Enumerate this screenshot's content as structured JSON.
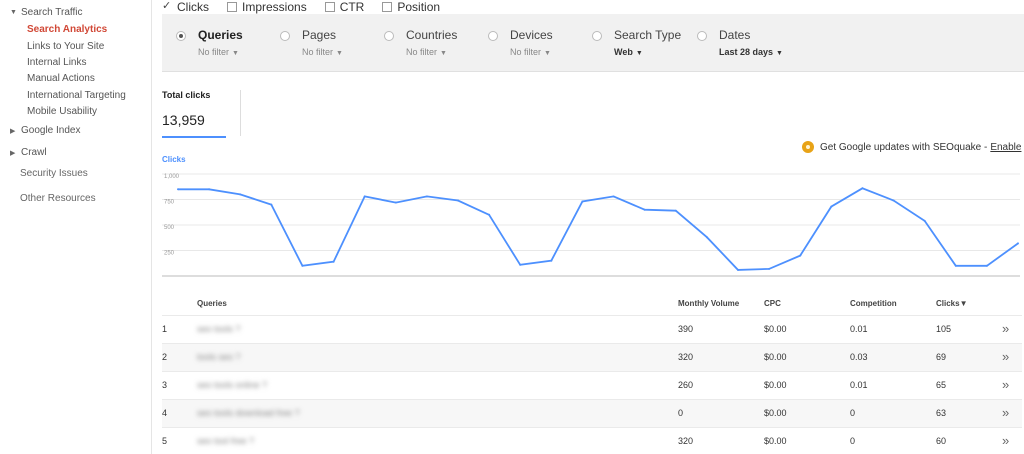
{
  "sidebar": {
    "search_traffic": "Search Traffic",
    "sub_items": [
      "Search Analytics",
      "Links to Your Site",
      "Internal Links",
      "Manual Actions",
      "International Targeting",
      "Mobile Usability"
    ],
    "google_index": "Google Index",
    "crawl": "Crawl",
    "security_issues": "Security Issues",
    "other_resources": "Other Resources"
  },
  "metrics": [
    {
      "label": "Clicks",
      "checked": true
    },
    {
      "label": "Impressions",
      "checked": false
    },
    {
      "label": "CTR",
      "checked": false
    },
    {
      "label": "Position",
      "checked": false
    }
  ],
  "filters": [
    {
      "label": "Queries",
      "sub": "No filter",
      "selected": true
    },
    {
      "label": "Pages",
      "sub": "No filter",
      "selected": false
    },
    {
      "label": "Countries",
      "sub": "No filter",
      "selected": false
    },
    {
      "label": "Devices",
      "sub": "No filter",
      "selected": false
    },
    {
      "label": "Search Type",
      "sub": "Web",
      "selected": false
    },
    {
      "label": "Dates",
      "sub": "Last 28 days",
      "selected": false
    }
  ],
  "total": {
    "label": "Total clicks",
    "value": "13,959"
  },
  "seoquake": {
    "text": "Get Google updates with SEOquake -",
    "link": "Enable"
  },
  "chart_data": {
    "type": "line",
    "title": "Clicks",
    "ylim": [
      0,
      1000
    ],
    "yticks": [
      "1,000",
      "750",
      "500",
      "250"
    ],
    "ytick_values": [
      1000,
      750,
      500,
      250
    ],
    "series": [
      {
        "values": [
          850,
          850,
          800,
          700,
          100,
          140,
          780,
          720,
          780,
          740,
          600,
          110,
          150,
          730,
          780,
          650,
          640,
          380,
          60,
          70,
          200,
          680,
          860,
          740,
          540,
          100,
          100,
          320
        ]
      }
    ],
    "color": "#4d90fe"
  },
  "table": {
    "headers": [
      "Queries",
      "Monthly Volume",
      "CPC",
      "Competition",
      "Clicks"
    ],
    "sort_marker": "▼",
    "rows": [
      {
        "n": "1",
        "query": "seo tools ?",
        "volume": "390",
        "cpc": "$0.00",
        "comp": "0.01",
        "clicks": "105"
      },
      {
        "n": "2",
        "query": "tools seo ?",
        "volume": "320",
        "cpc": "$0.00",
        "comp": "0.03",
        "clicks": "69"
      },
      {
        "n": "3",
        "query": "seo tools online ?",
        "volume": "260",
        "cpc": "$0.00",
        "comp": "0.01",
        "clicks": "65"
      },
      {
        "n": "4",
        "query": "seo tools download free ?",
        "volume": "0",
        "cpc": "$0.00",
        "comp": "0",
        "clicks": "63"
      },
      {
        "n": "5",
        "query": "seo tool free ?",
        "volume": "320",
        "cpc": "$0.00",
        "comp": "0",
        "clicks": "60"
      }
    ],
    "row_action": "»"
  }
}
